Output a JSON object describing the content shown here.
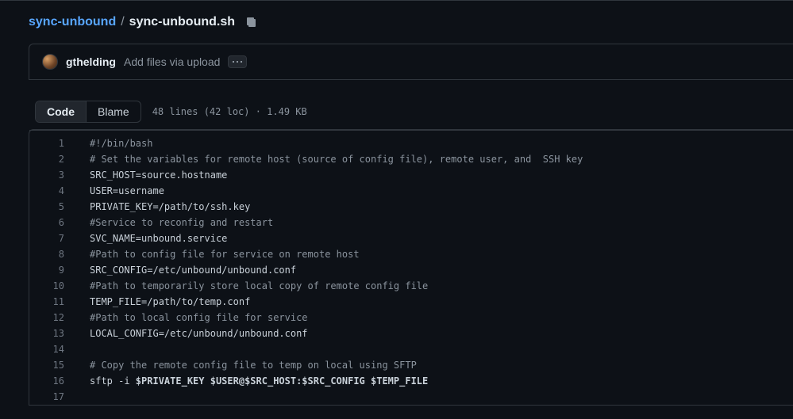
{
  "breadcrumb": {
    "repo": "sync-unbound",
    "separator": "/",
    "file": "sync-unbound.sh"
  },
  "commit": {
    "author": "gthelding",
    "message": "Add files via upload"
  },
  "tabs": {
    "code": "Code",
    "blame": "Blame"
  },
  "fileinfo": "48 lines (42 loc) · 1.49 KB",
  "code": {
    "lines": [
      {
        "n": "1",
        "segs": [
          {
            "c": "tok-comment",
            "t": "#!/bin/bash"
          }
        ]
      },
      {
        "n": "2",
        "segs": [
          {
            "c": "tok-comment",
            "t": "# Set the variables for remote host (source of config file), remote user, and  SSH key"
          }
        ]
      },
      {
        "n": "3",
        "segs": [
          {
            "c": "tok-plain",
            "t": "SRC_HOST=source.hostname"
          }
        ]
      },
      {
        "n": "4",
        "segs": [
          {
            "c": "tok-plain",
            "t": "USER=username"
          }
        ]
      },
      {
        "n": "5",
        "segs": [
          {
            "c": "tok-plain",
            "t": "PRIVATE_KEY=/path/to/ssh.key"
          }
        ]
      },
      {
        "n": "6",
        "segs": [
          {
            "c": "tok-comment",
            "t": "#Service to reconfig and restart"
          }
        ]
      },
      {
        "n": "7",
        "segs": [
          {
            "c": "tok-plain",
            "t": "SVC_NAME=unbound.service"
          }
        ]
      },
      {
        "n": "8",
        "segs": [
          {
            "c": "tok-comment",
            "t": "#Path to config file for service on remote host"
          }
        ]
      },
      {
        "n": "9",
        "segs": [
          {
            "c": "tok-plain",
            "t": "SRC_CONFIG=/etc/unbound/unbound.conf"
          }
        ]
      },
      {
        "n": "10",
        "segs": [
          {
            "c": "tok-comment",
            "t": "#Path to temporarily store local copy of remote config file"
          }
        ]
      },
      {
        "n": "11",
        "segs": [
          {
            "c": "tok-plain",
            "t": "TEMP_FILE=/path/to/temp.conf"
          }
        ]
      },
      {
        "n": "12",
        "segs": [
          {
            "c": "tok-comment",
            "t": "#Path to local config file for service"
          }
        ]
      },
      {
        "n": "13",
        "segs": [
          {
            "c": "tok-plain",
            "t": "LOCAL_CONFIG=/etc/unbound/unbound.conf"
          }
        ]
      },
      {
        "n": "14",
        "segs": [
          {
            "c": "tok-plain",
            "t": ""
          }
        ]
      },
      {
        "n": "15",
        "segs": [
          {
            "c": "tok-comment",
            "t": "# Copy the remote config file to temp on local using SFTP"
          }
        ]
      },
      {
        "n": "16",
        "segs": [
          {
            "c": "tok-plain",
            "t": "sftp -i "
          },
          {
            "c": "tok-var",
            "t": "$PRIVATE_KEY $USER@$SRC_HOST:$SRC_CONFIG $TEMP_FILE"
          }
        ]
      },
      {
        "n": "17",
        "segs": [
          {
            "c": "tok-plain",
            "t": ""
          }
        ]
      }
    ]
  }
}
